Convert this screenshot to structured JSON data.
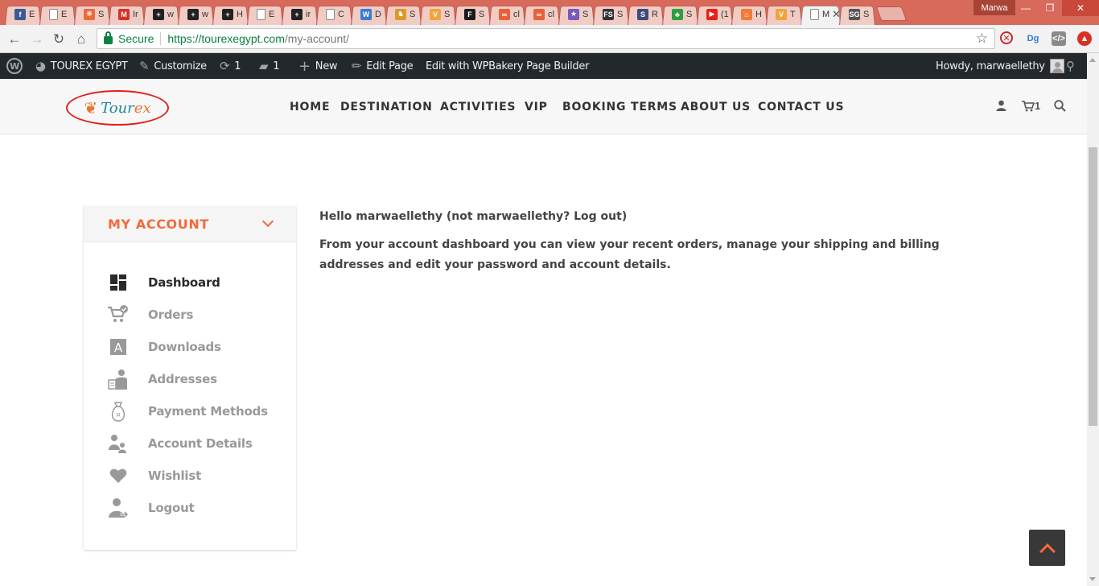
{
  "browser": {
    "tabs": [
      {
        "title": "E",
        "icon": "facebook-icon",
        "color": "#3b5998",
        "glyph": "f"
      },
      {
        "title": "E",
        "icon": "page-icon",
        "color": "#ffffff",
        "glyph": ""
      },
      {
        "title": "S",
        "icon": "swirl-icon",
        "color": "#e86b3a",
        "glyph": "❋"
      },
      {
        "title": "Ir",
        "icon": "gmail-icon",
        "color": "#d93025",
        "glyph": "M"
      },
      {
        "title": "w",
        "icon": "plus-box-icon",
        "color": "#222222",
        "glyph": "+"
      },
      {
        "title": "w",
        "icon": "plus-box-icon",
        "color": "#222222",
        "glyph": "+"
      },
      {
        "title": "H",
        "icon": "plus-box-icon",
        "color": "#222222",
        "glyph": "+"
      },
      {
        "title": "E",
        "icon": "page-icon",
        "color": "#ffffff",
        "glyph": ""
      },
      {
        "title": "ir",
        "icon": "plus-box-icon",
        "color": "#222222",
        "glyph": "+"
      },
      {
        "title": "C",
        "icon": "page-icon",
        "color": "#ffffff",
        "glyph": ""
      },
      {
        "title": "D",
        "icon": "wordpress-icon",
        "color": "#3a7bd5",
        "glyph": "W"
      },
      {
        "title": "S",
        "icon": "camel-icon",
        "color": "#d99a2b",
        "glyph": "♞"
      },
      {
        "title": "S",
        "icon": "v-icon",
        "color": "#f2a33a",
        "glyph": "V"
      },
      {
        "title": "S",
        "icon": "f-icon",
        "color": "#1b1b1b",
        "glyph": "F"
      },
      {
        "title": "cl",
        "icon": "link-icon",
        "color": "#e8613a",
        "glyph": "∞"
      },
      {
        "title": "cl",
        "icon": "link-icon",
        "color": "#e8613a",
        "glyph": "∞"
      },
      {
        "title": "S",
        "icon": "star-icon",
        "color": "#7a5ab8",
        "glyph": "★"
      },
      {
        "title": "S",
        "icon": "fs-icon",
        "color": "#333333",
        "glyph": "FS"
      },
      {
        "title": "R",
        "icon": "s-icon",
        "color": "#3b4b7a",
        "glyph": "S"
      },
      {
        "title": "S",
        "icon": "palm-icon",
        "color": "#2e9e3e",
        "glyph": "♣"
      },
      {
        "title": "(1",
        "icon": "youtube-icon",
        "color": "#e62117",
        "glyph": "▶"
      },
      {
        "title": "H",
        "icon": "hubspot-icon",
        "color": "#f27a3a",
        "glyph": "⌂"
      },
      {
        "title": "T",
        "icon": "v-icon",
        "color": "#f2a33a",
        "glyph": "V"
      },
      {
        "title": "M",
        "icon": "page-icon",
        "color": "#ffffff",
        "glyph": "",
        "active": true
      },
      {
        "title": "S",
        "icon": "sg-icon",
        "color": "#555555",
        "glyph": "SG"
      }
    ],
    "profile_name": "Marwa",
    "secure_label": "Secure",
    "url_host": "https://tourexegypt.com",
    "url_path": "/my-account/"
  },
  "adminbar": {
    "site_name": "TOUREX EGYPT",
    "customize": "Customize",
    "updates_count": "1",
    "comments_count": "1",
    "new_label": "New",
    "edit_page": "Edit Page",
    "wpbakery": "Edit with WPBakery Page Builder",
    "howdy": "Howdy, marwaellethy"
  },
  "header": {
    "logo_text_a": "Tour",
    "logo_text_b": "ex",
    "menu": [
      "HOME",
      "DESTINATION",
      "ACTIVITIES",
      "VIP",
      "BOOKING TERMS",
      "ABOUT US",
      "CONTACT US"
    ],
    "cart_count": "1"
  },
  "account": {
    "title": "MY ACCOUNT",
    "items": [
      {
        "label": "Dashboard",
        "icon": "dashboard-icon"
      },
      {
        "label": "Orders",
        "icon": "cart-check-icon"
      },
      {
        "label": "Downloads",
        "icon": "download-a-icon"
      },
      {
        "label": "Addresses",
        "icon": "address-icon"
      },
      {
        "label": "Payment Methods",
        "icon": "money-bag-icon"
      },
      {
        "label": "Account Details",
        "icon": "user-details-icon"
      },
      {
        "label": "Wishlist",
        "icon": "heart-icon"
      },
      {
        "label": "Logout",
        "icon": "logout-user-icon"
      }
    ]
  },
  "content": {
    "hello": "Hello marwaellethy (not marwaellethy? Log out)",
    "dashboard_text": "From your account dashboard you can view your recent orders, manage your shipping and billing addresses and edit your password and account details."
  },
  "colors": {
    "accent": "#f26b3a",
    "tabstrip": "#d86a5c",
    "adminbar": "#23282d"
  }
}
